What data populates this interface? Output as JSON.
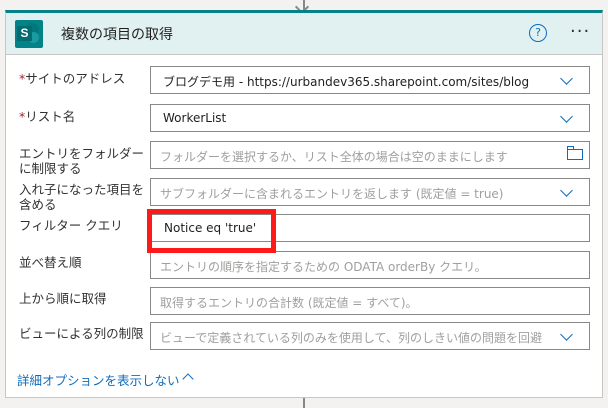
{
  "header": {
    "title": "複数の項目の取得",
    "help_symbol": "?",
    "more_symbol": "···",
    "logo_letter": "S",
    "accent": "#038387"
  },
  "fields": {
    "site": {
      "label": "サイトのアドレス",
      "required": "*",
      "value": "ブログデモ用 - https://urbandev365.sharepoint.com/sites/blog"
    },
    "list": {
      "label": "リスト名",
      "required": "*",
      "value": "WorkerList"
    },
    "folder": {
      "label_line1": "エントリをフォルダー",
      "label_line2": "に制限する",
      "placeholder": "フォルダーを選択するか、リスト全体の場合は空のままにします"
    },
    "nested": {
      "label_line1": "入れ子になった項目を",
      "label_line2": "含める",
      "placeholder": "サブフォルダーに含まれるエントリを返します (既定値 = true)"
    },
    "filter": {
      "label": "フィルター クエリ",
      "value": "Notice eq 'true'"
    },
    "order": {
      "label": "並べ替え順",
      "placeholder": "エントリの順序を指定するための ODATA orderBy クエリ。"
    },
    "top": {
      "label": "上から順に取得",
      "placeholder": "取得するエントリの合計数 (既定値 = すべて)。"
    },
    "view": {
      "label": "ビューによる列の制限",
      "placeholder": "ビューで定義されている列のみを使用して、列のしきい値の問題を回避"
    }
  },
  "advanced_link": "詳細オプションを表示しない",
  "highlight_color": "#ff1a1a"
}
